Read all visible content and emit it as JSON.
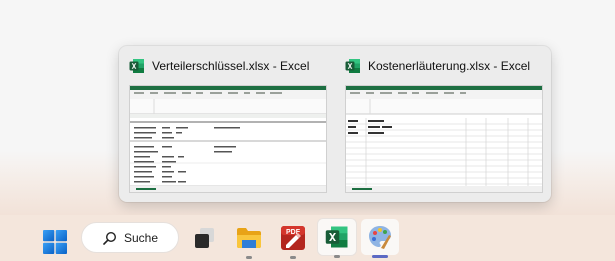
{
  "taskbar": {
    "search_label": "Suche",
    "pinned": [
      {
        "name": "Start",
        "icon": "windows-logo-icon"
      },
      {
        "name": "Task View",
        "icon": "task-view-icon"
      },
      {
        "name": "File Explorer",
        "icon": "folder-icon",
        "running": true
      },
      {
        "name": "PDF Editor",
        "icon": "pdf-icon",
        "running": true
      },
      {
        "name": "Excel",
        "icon": "excel-icon",
        "running": true
      },
      {
        "name": "Paint",
        "icon": "paint-palette-icon",
        "running": true,
        "active": true
      }
    ]
  },
  "preview": {
    "windows": [
      {
        "title": "Verteilerschlüssel.xlsx - Excel",
        "icon": "excel-icon"
      },
      {
        "title": "Kostenerläuterung.xlsx - Excel",
        "icon": "excel-icon"
      }
    ]
  },
  "colors": {
    "excel_green": "#1d6f42",
    "accent_indicator": "#5c6ac4",
    "taskbar_bg": "#f4e6dc"
  }
}
